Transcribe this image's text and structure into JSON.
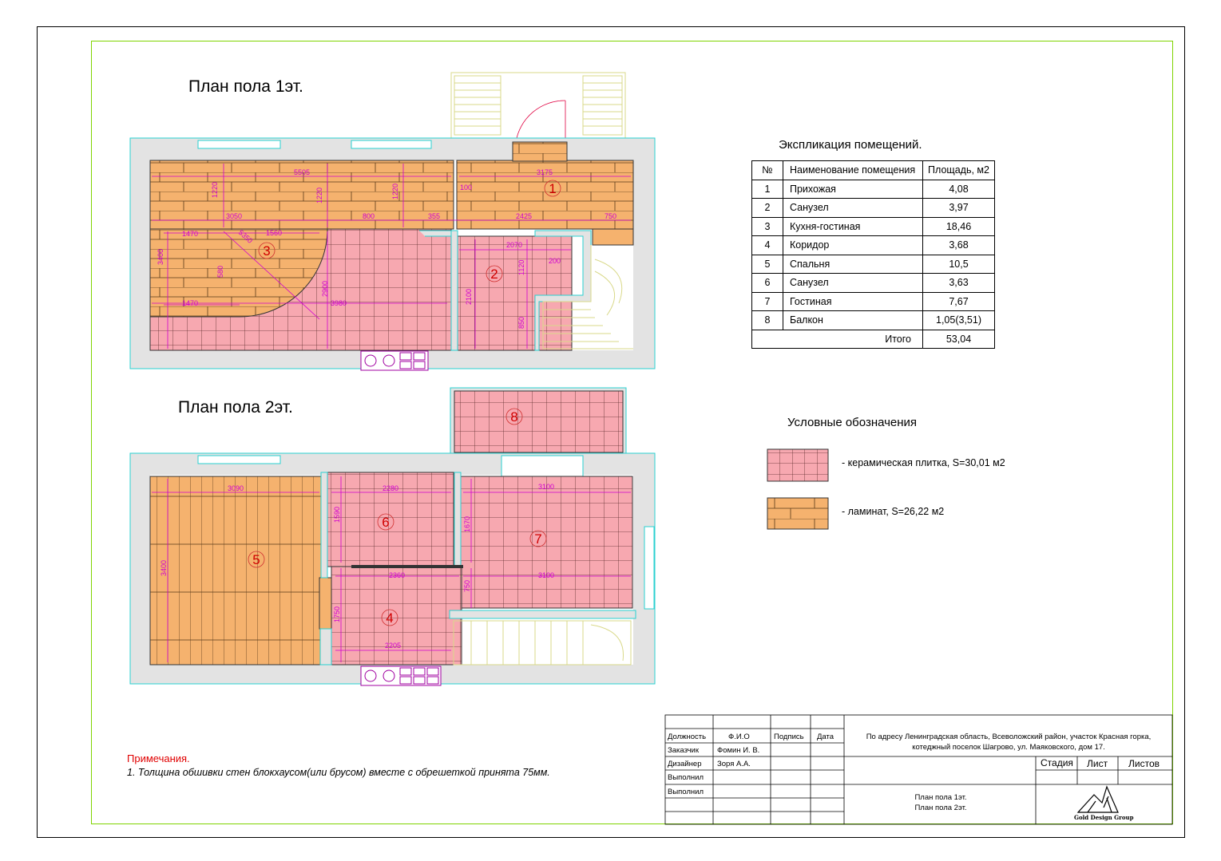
{
  "plan1": {
    "title": "План пола 1эт.",
    "dims": [
      "5505",
      "1220",
      "1220",
      "1220",
      "3175",
      "100",
      "3050",
      "800",
      "355",
      "2425",
      "750",
      "1470",
      "1560",
      "5350",
      "3400",
      "2070",
      "200",
      "1120",
      "2900",
      "3980",
      "1470",
      "580",
      "2100",
      "850"
    ],
    "room_labels": [
      "1",
      "2",
      "3"
    ]
  },
  "plan2": {
    "title": "План пола 2эт.",
    "dims": [
      "3090",
      "3400",
      "2280",
      "1590",
      "3100",
      "1670",
      "2360",
      "3100",
      "750",
      "1750",
      "2205"
    ],
    "room_labels": [
      "4",
      "5",
      "6",
      "7",
      "8"
    ]
  },
  "explication": {
    "title": "Экспликация помещений.",
    "headers": [
      "№",
      "Наименование помещения",
      "Площадь, м2"
    ],
    "rows": [
      {
        "num": "1",
        "name": "Прихожая",
        "area": "4,08"
      },
      {
        "num": "2",
        "name": "Санузел",
        "area": "3,97"
      },
      {
        "num": "3",
        "name": "Кухня-гостиная",
        "area": "18,46"
      },
      {
        "num": "4",
        "name": "Коридор",
        "area": "3,68"
      },
      {
        "num": "5",
        "name": "Спальня",
        "area": "10,5"
      },
      {
        "num": "6",
        "name": "Санузел",
        "area": "3,63"
      },
      {
        "num": "7",
        "name": "Гостиная",
        "area": "7,67"
      },
      {
        "num": "8",
        "name": "Балкон",
        "area": "1,05(3,51)"
      }
    ],
    "total_label": "Итого",
    "total_value": "53,04"
  },
  "legend": {
    "title": "Условные обозначения",
    "items": [
      {
        "text": "- керамическая плитка, S=30,01 м2"
      },
      {
        "text": "- ламинат, S=26,22 м2"
      }
    ]
  },
  "notes": {
    "title": "Примечания.",
    "line1": "1. Толщина обшивки стен блокхаусом(или брусом) вместе с обрешеткой принята 75мм."
  },
  "title_block": {
    "h_role": "Должность",
    "h_name": "Ф.И.О",
    "h_sign": "Подпись",
    "h_date": "Дата",
    "r1_role": "Заказчик",
    "r1_name": "Фомин И. В.",
    "r2_role": "Дизайнер",
    "r2_name": "Зоря А.А.",
    "r3_role": "Выполнил",
    "r4_role": "Выполнил",
    "address_line1": "По адресу Ленинградская область, Всеволожский район, участок Красная горка,",
    "address_line2": "котеджный поселок Шагрово, ул. Маяковского, дом 17.",
    "stage": "Стадия",
    "sheet": "Лист",
    "sheets": "Листов",
    "drawing_line1": "План пола 1эт.",
    "drawing_line2": "План пола 2эт.",
    "logo_text": "Gold Design Group"
  },
  "colors": {
    "tile_fill": "#f7a8b0",
    "laminate_fill": "#f5b26e",
    "dim_color": "#d000d0",
    "wall_fill": "#e3e3e3",
    "frame_green": "#7fd400",
    "stair_color": "#d9d98a"
  }
}
